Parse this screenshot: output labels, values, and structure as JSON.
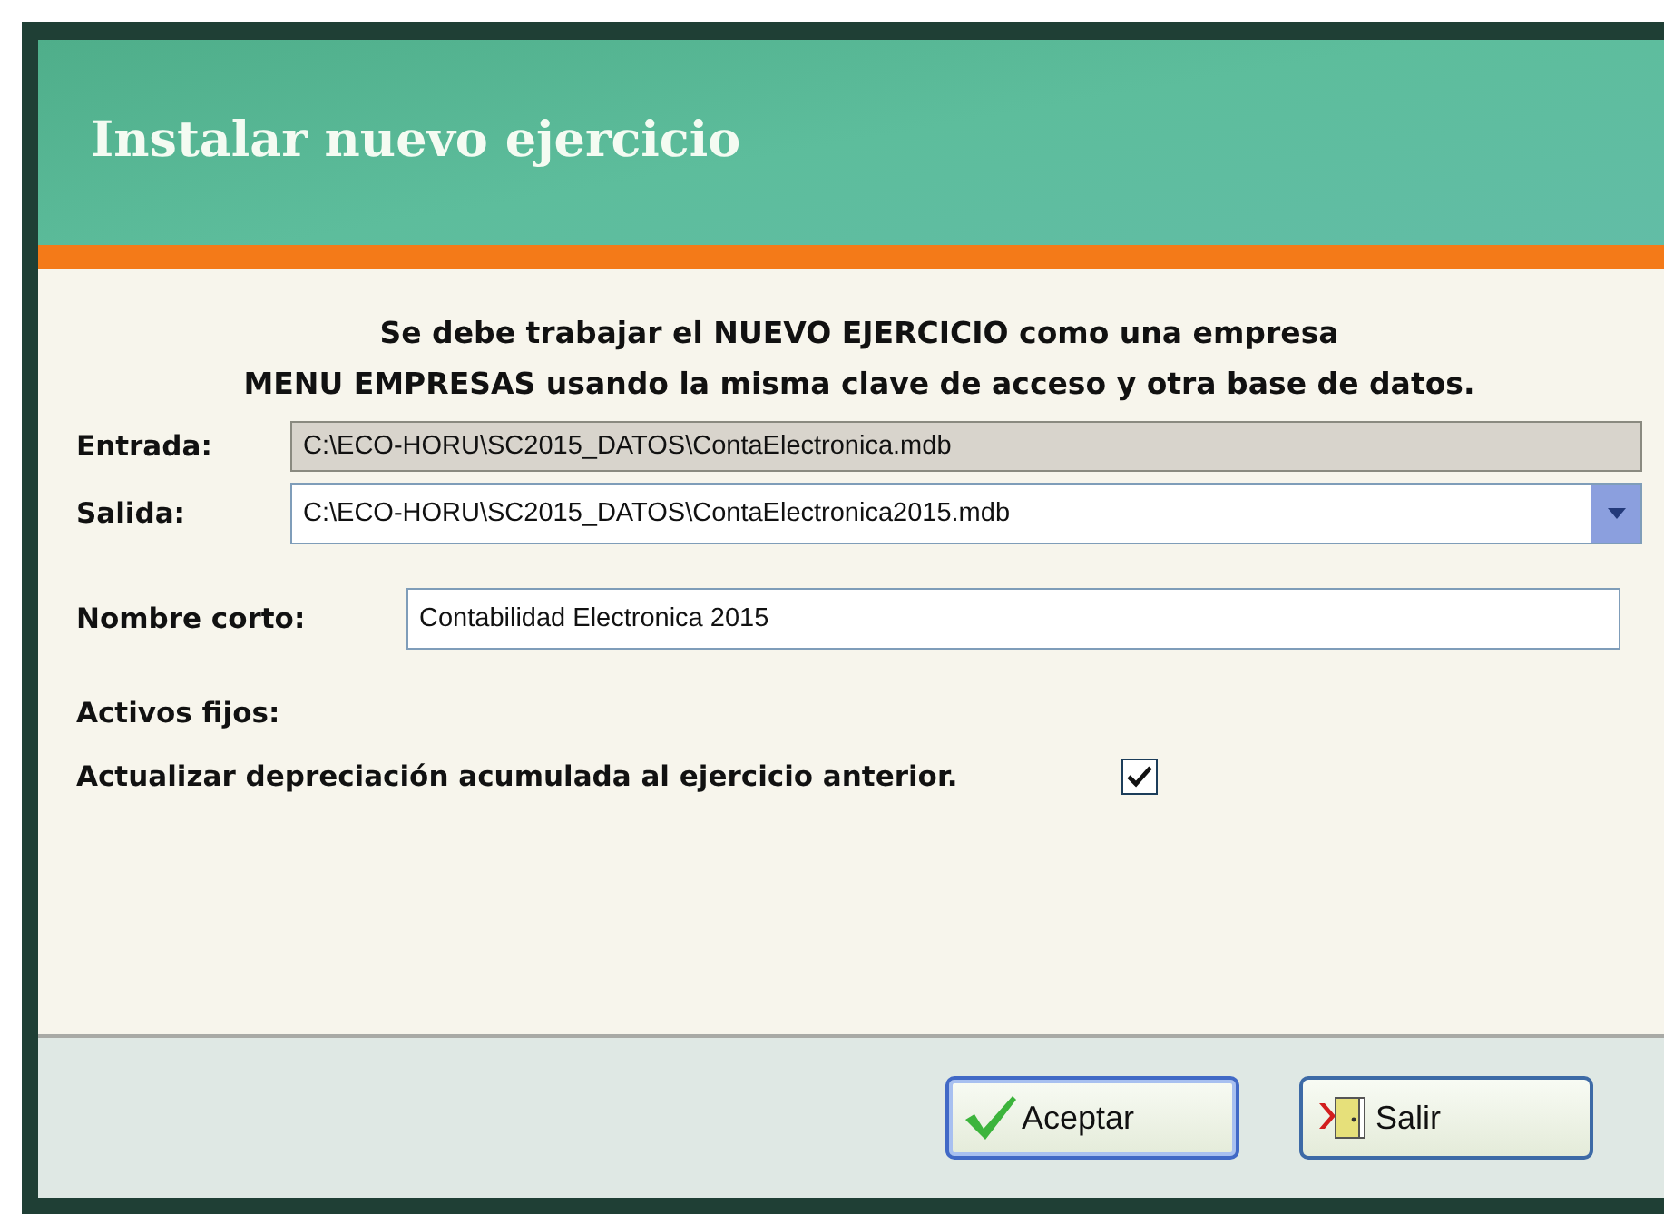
{
  "window": {
    "title": "Instalar nuevo ejercicio"
  },
  "message": [
    "Se debe trabajar el NUEVO EJERCICIO como una empresa",
    "MENU EMPRESAS usando la misma clave de acceso y otra base de datos."
  ],
  "fields": [
    {
      "kind": "readonly",
      "label": "Entrada:",
      "value": "C:\\ECO-HORU\\SC2015_DATOS\\ContaElectronica.mdb"
    },
    {
      "kind": "combo",
      "label": "Salida:",
      "value": "C:\\ECO-HORU\\SC2015_DATOS\\ContaElectronica2015.mdb"
    },
    {
      "kind": "text",
      "label": "Nombre corto:",
      "value": "Contabilidad Electronica 2015"
    }
  ],
  "section_label": "Activos fijos:",
  "option": {
    "label": "Actualizar depreciación acumulada al ejercicio anterior.",
    "checked": true
  },
  "buttons": [
    {
      "kind": "accept",
      "label": "Aceptar",
      "focused": true
    },
    {
      "kind": "exit",
      "label": "Salir",
      "focused": false
    }
  ]
}
